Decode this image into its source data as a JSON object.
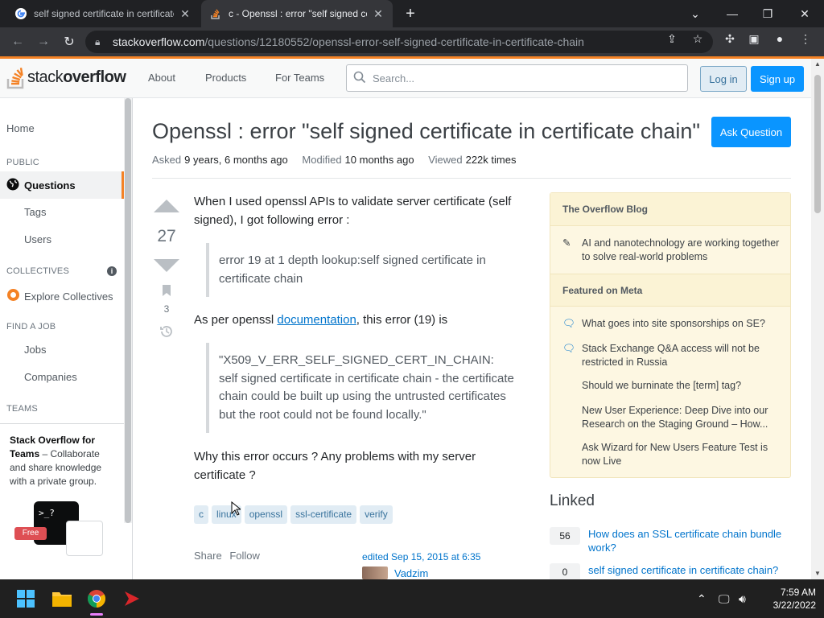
{
  "browser": {
    "tabs": [
      {
        "title": "self signed certificate in certificate chain",
        "active": false
      },
      {
        "title": "c - Openssl : error \"self signed certificate in certificate chain\"",
        "active": true
      }
    ],
    "url_host": "stackoverflow.com",
    "url_path": "/questions/12180552/openssl-error-self-signed-certificate-in-certificate-chain",
    "colors": {
      "frame": "#202124",
      "toolbar": "#35363a"
    }
  },
  "header": {
    "logo_a": "stack",
    "logo_b": "overflow",
    "nav": [
      "About",
      "Products",
      "For Teams"
    ],
    "search_placeholder": "Search...",
    "login_label": "Log in",
    "signup_label": "Sign up"
  },
  "sidebar": {
    "home": "Home",
    "public_heading": "PUBLIC",
    "questions": "Questions",
    "tags": "Tags",
    "users": "Users",
    "collectives_heading": "COLLECTIVES",
    "explore_collectives": "Explore Collectives",
    "find_job_heading": "FIND A JOB",
    "jobs": "Jobs",
    "companies": "Companies",
    "teams_heading": "TEAMS",
    "teams_title": "Stack Overflow for Teams",
    "teams_dash": " – ",
    "teams_text": "Collaborate and share knowledge with a private group.",
    "free_badge": "Free"
  },
  "question": {
    "title": "Openssl : error \"self signed certificate in certificate chain\"",
    "ask_button": "Ask Question",
    "asked_label": "Asked",
    "asked_value": "9 years, 6 months ago",
    "modified_label": "Modified",
    "modified_value": "10 months ago",
    "viewed_label": "Viewed",
    "viewed_value": "222k times",
    "score": "27",
    "bookmarks": "3",
    "para1": "When I used openssl APIs to validate server certificate (self signed), I got following error :",
    "quote1": "error 19 at 1 depth lookup:self signed certificate in certificate chain",
    "para2_before": "As per openssl ",
    "para2_link": "documentation",
    "para2_after": ", this error (19) is",
    "quote2": "\"X509_V_ERR_SELF_SIGNED_CERT_IN_CHAIN: self signed certificate in certificate chain - the certificate chain could be built up using the untrusted certificates but the root could not be found locally.\"",
    "para3": "Why this error occurs ? Any problems with my server certificate ?",
    "tags": [
      "c",
      "linux",
      "openssl",
      "ssl-certificate",
      "verify"
    ],
    "share": "Share",
    "follow": "Follow",
    "edited": "edited Sep 15, 2015 at 6:35",
    "editor": "Vadzim"
  },
  "blog": {
    "heading": "The Overflow Blog",
    "items": [
      "AI and nanotechnology are working together to solve real-world problems"
    ],
    "meta_heading": "Featured on Meta",
    "meta_items": [
      "What goes into site sponsorships on SE?",
      "Stack Exchange Q&A access will not be restricted in Russia",
      "Should we burninate the [term] tag?",
      "New User Experience: Deep Dive into our Research on the Staging Ground – How...",
      "Ask Wizard for New Users Feature Test is now Live"
    ]
  },
  "linked": {
    "heading": "Linked",
    "items": [
      {
        "count": "56",
        "text": "How does an SSL certificate chain bundle work?"
      },
      {
        "count": "0",
        "text": "self signed certificate in certificate chain?"
      }
    ]
  },
  "taskbar": {
    "time": "7:59 AM",
    "date": "3/22/2022"
  },
  "colors": {
    "so_orange": "#f48225",
    "so_blue": "#0a95ff",
    "tag_bg": "#e1ecf4",
    "blog_bg": "#fdf7e2"
  }
}
